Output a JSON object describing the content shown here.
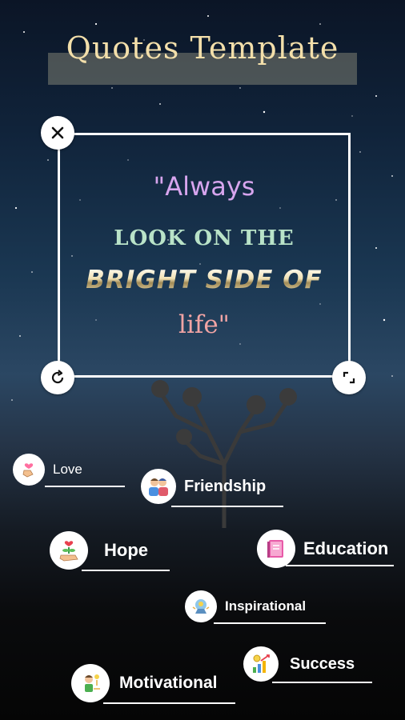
{
  "header": {
    "title": "Quotes Template"
  },
  "quote": {
    "line1": "\"Always",
    "line2": "LOOK ON THE",
    "line3": "BRIGHT SIDE OF",
    "line4": "life\""
  },
  "categories": {
    "love": "Love",
    "friendship": "Friendship",
    "hope": "Hope",
    "education": "Education",
    "inspirational": "Inspirational",
    "success": "Success",
    "motivational": "Motivational"
  },
  "icons": {
    "close": "close-icon",
    "rotate": "rotate-icon",
    "resize": "resize-icon"
  },
  "colors": {
    "title": "#f3dfaa",
    "quote_always": "#d7a5ee",
    "quote_look": "#b9e3c8",
    "quote_life": "#f2a4a4"
  }
}
